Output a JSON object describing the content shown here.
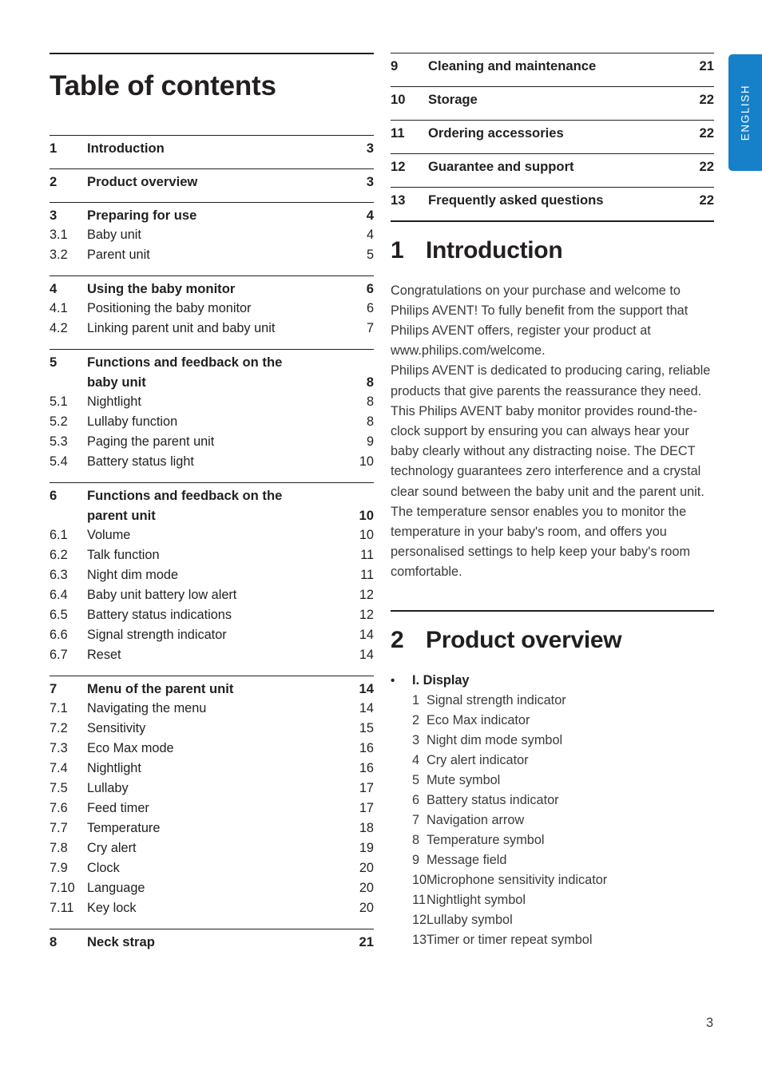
{
  "language_tab": {
    "label": "ENGLISH",
    "color": "#1680c8"
  },
  "page_number": "3",
  "left_column": {
    "title": "Table of contents",
    "entries": [
      {
        "num": "1",
        "label": "Introduction",
        "page": "3",
        "level": "major"
      },
      {
        "num": "2",
        "label": "Product overview",
        "page": "3",
        "level": "major"
      },
      {
        "num": "3",
        "label": "Preparing for use",
        "page": "4",
        "level": "major"
      },
      {
        "num": "3.1",
        "label": "Baby unit",
        "page": "4",
        "level": "sub"
      },
      {
        "num": "3.2",
        "label": "Parent unit",
        "page": "5",
        "level": "sub"
      },
      {
        "num": "4",
        "label": "Using the baby monitor",
        "page": "6",
        "level": "major"
      },
      {
        "num": "4.1",
        "label": "Positioning the baby monitor",
        "page": "6",
        "level": "sub"
      },
      {
        "num": "4.2",
        "label": "Linking parent unit and baby unit",
        "page": "7",
        "level": "sub"
      },
      {
        "num": "5",
        "label": "Functions and feedback on the",
        "label2": "baby unit",
        "page": "8",
        "level": "major-two"
      },
      {
        "num": "5.1",
        "label": "Nightlight",
        "page": "8",
        "level": "sub"
      },
      {
        "num": "5.2",
        "label": "Lullaby function",
        "page": "8",
        "level": "sub"
      },
      {
        "num": "5.3",
        "label": "Paging the parent unit",
        "page": "9",
        "level": "sub"
      },
      {
        "num": "5.4",
        "label": "Battery status light",
        "page": "10",
        "level": "sub"
      },
      {
        "num": "6",
        "label": "Functions and feedback on the",
        "label2": "parent unit",
        "page": "10",
        "level": "major-two"
      },
      {
        "num": "6.1",
        "label": "Volume",
        "page": "10",
        "level": "sub"
      },
      {
        "num": "6.2",
        "label": "Talk function",
        "page": "11",
        "level": "sub"
      },
      {
        "num": "6.3",
        "label": "Night dim mode",
        "page": "11",
        "level": "sub"
      },
      {
        "num": "6.4",
        "label": "Baby unit battery low alert",
        "page": "12",
        "level": "sub"
      },
      {
        "num": "6.5",
        "label": "Battery status indications",
        "page": "12",
        "level": "sub"
      },
      {
        "num": "6.6",
        "label": "Signal strength indicator",
        "page": "14",
        "level": "sub"
      },
      {
        "num": "6.7",
        "label": "Reset",
        "page": "14",
        "level": "sub"
      },
      {
        "num": "7",
        "label": "Menu of the parent unit",
        "page": "14",
        "level": "major"
      },
      {
        "num": "7.1",
        "label": "Navigating the menu",
        "page": "14",
        "level": "sub"
      },
      {
        "num": "7.2",
        "label": "Sensitivity",
        "page": "15",
        "level": "sub"
      },
      {
        "num": "7.3",
        "label": "Eco Max mode",
        "page": "16",
        "level": "sub"
      },
      {
        "num": "7.4",
        "label": "Nightlight",
        "page": "16",
        "level": "sub"
      },
      {
        "num": "7.5",
        "label": "Lullaby",
        "page": "17",
        "level": "sub"
      },
      {
        "num": "7.6",
        "label": "Feed timer",
        "page": "17",
        "level": "sub"
      },
      {
        "num": "7.7",
        "label": "Temperature",
        "page": "18",
        "level": "sub"
      },
      {
        "num": "7.8",
        "label": "Cry alert",
        "page": "19",
        "level": "sub"
      },
      {
        "num": "7.9",
        "label": "Clock",
        "page": "20",
        "level": "sub"
      },
      {
        "num": "7.10",
        "label": "Language",
        "page": "20",
        "level": "sub"
      },
      {
        "num": "7.11",
        "label": "Key lock",
        "page": "20",
        "level": "sub"
      },
      {
        "num": "8",
        "label": "Neck strap",
        "page": "21",
        "level": "major"
      }
    ]
  },
  "right_column": {
    "entries": [
      {
        "num": "9",
        "label": "Cleaning and maintenance",
        "page": "21",
        "level": "major"
      },
      {
        "num": "10",
        "label": "Storage",
        "page": "22",
        "level": "major"
      },
      {
        "num": "11",
        "label": "Ordering accessories",
        "page": "22",
        "level": "major"
      },
      {
        "num": "12",
        "label": "Guarantee and support",
        "page": "22",
        "level": "major"
      },
      {
        "num": "13",
        "label": "Frequently asked questions",
        "page": "22",
        "level": "major"
      }
    ],
    "introduction": {
      "number": "1",
      "title": "Introduction",
      "paragraph1": "Congratulations on your purchase and welcome to Philips AVENT! To fully benefit from the support that Philips AVENT offers, register your product at www.philips.com/welcome.",
      "paragraph2": "Philips AVENT is dedicated to producing caring, reliable products that give parents the reassurance they need. This Philips AVENT baby monitor provides round-the-clock support by ensuring you can always hear your baby clearly without any distracting noise. The DECT technology guarantees zero interference and a crystal clear sound between the baby unit and the parent unit. The temperature sensor enables you to monitor the temperature in your baby's room, and offers you personalised settings to help keep your baby's room comfortable."
    },
    "product_overview": {
      "number": "2",
      "title": "Product overview",
      "bullet": "•",
      "group_label": "I. Display",
      "items": [
        {
          "idx": "1",
          "text": "Signal strength indicator"
        },
        {
          "idx": "2",
          "text": "Eco Max indicator"
        },
        {
          "idx": "3",
          "text": "Night dim mode symbol"
        },
        {
          "idx": "4",
          "text": "Cry alert indicator"
        },
        {
          "idx": "5",
          "text": "Mute symbol"
        },
        {
          "idx": "6",
          "text": "Battery status indicator"
        },
        {
          "idx": "7",
          "text": "Navigation arrow"
        },
        {
          "idx": "8",
          "text": "Temperature symbol"
        },
        {
          "idx": "9",
          "text": "Message field"
        },
        {
          "idx": "10",
          "text": "Microphone sensitivity indicator"
        },
        {
          "idx": "11",
          "text": "Nightlight symbol"
        },
        {
          "idx": "12",
          "text": "Lullaby symbol"
        },
        {
          "idx": "13",
          "text": "Timer or timer repeat symbol"
        }
      ]
    }
  }
}
